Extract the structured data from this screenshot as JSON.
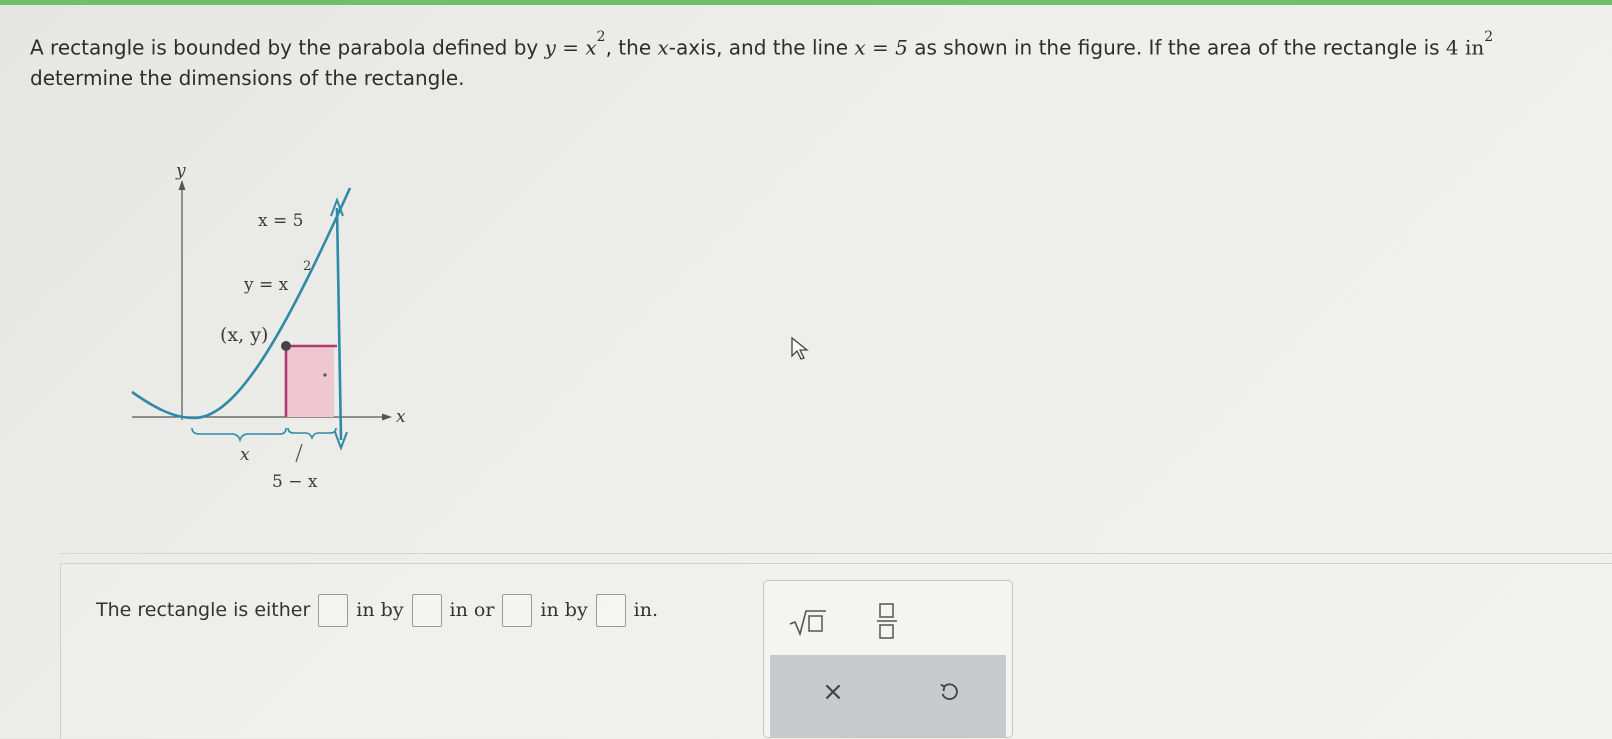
{
  "problem": {
    "text_before": "A rectangle is bounded by the parabola defined by ",
    "eq1": "y = x",
    "exp": "2",
    "text_mid1": ", the ",
    "var_x": "x",
    "text_mid2": "-axis, and the line ",
    "eq2": "x = 5",
    "text_mid3": " as shown in the figure. If the area of the rectangle is ",
    "area_value": "4 in",
    "text_line2": "determine the dimensions of the rectangle."
  },
  "figure": {
    "y_axis_label": "y",
    "x_axis_label": "x",
    "line_label": "x = 5",
    "parabola_label": "y = x",
    "parabola_exp": "2",
    "point_label": "(x, y)",
    "bottom_label_x": "x",
    "bottom_label_5mx": "5 − x"
  },
  "answer": {
    "prefix": "The rectangle is either",
    "in_by_1": "in by",
    "in_or": "in or",
    "in_by_2": "in by",
    "in_end": "in."
  },
  "colors": {
    "curve": "#2f8aa8",
    "rectangle_edge": "#b03a6e",
    "rectangle_fill": "#efc7d3",
    "axis": "#555555"
  },
  "tools": {
    "sqrt_icon": "square-root-icon",
    "fraction_icon": "fraction-icon",
    "clear_label": "×",
    "undo_icon": "undo-icon"
  }
}
